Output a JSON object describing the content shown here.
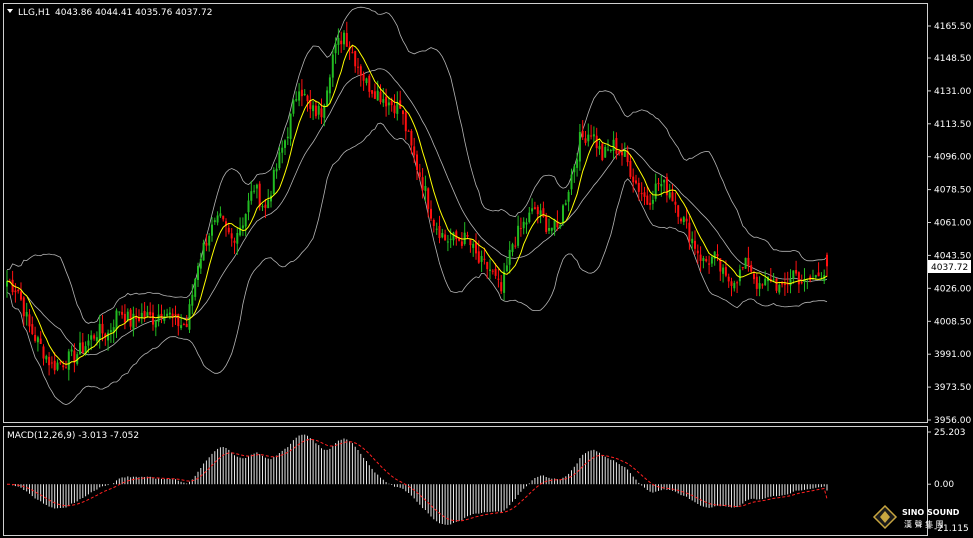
{
  "header": {
    "menu_arrow": "triangle-down-icon",
    "symbol": "LLG,H1",
    "ohlc": "4043.86 4044.41 4035.76 4037.72"
  },
  "macd_label": "MACD(12,26,9) -3.013 -7.052",
  "price_badge": "4037.72",
  "price_ticks": [
    "4165.50",
    "4148.50",
    "4131.00",
    "4113.50",
    "4096.00",
    "4078.50",
    "4061.00",
    "4043.50",
    "4026.00",
    "4008.50",
    "3991.00",
    "3973.50",
    "3956.00"
  ],
  "macd_ticks": [
    "25.203",
    "0.00",
    "-21.115"
  ],
  "logo": {
    "en": "SINO SOUND",
    "cn": "漢 聲 集 團"
  },
  "colors": {
    "bull": "#22bb22",
    "bear": "#ff1010",
    "ma": "#ffff00",
    "band": "#b4b4b4",
    "signal": "#ff2020",
    "hist": "#e6e6e6"
  },
  "chart_data": {
    "type": "candlestick",
    "interval": "H1",
    "y_range": [
      3956.0,
      4174.0
    ],
    "bands_close_anchors": [
      [
        0,
        4030
      ],
      [
        4,
        4025
      ],
      [
        8,
        4005
      ],
      [
        12,
        3995
      ],
      [
        16,
        3985
      ],
      [
        20,
        3987
      ],
      [
        24,
        3990
      ],
      [
        28,
        3996
      ],
      [
        32,
        4003
      ],
      [
        36,
        4002
      ],
      [
        40,
        4015
      ],
      [
        44,
        4008
      ],
      [
        48,
        4012
      ],
      [
        52,
        4010
      ],
      [
        56,
        4015
      ],
      [
        60,
        4008
      ],
      [
        64,
        4006
      ],
      [
        68,
        4040
      ],
      [
        72,
        4056
      ],
      [
        76,
        4062
      ],
      [
        80,
        4052
      ],
      [
        84,
        4062
      ],
      [
        88,
        4080
      ],
      [
        92,
        4068
      ],
      [
        96,
        4090
      ],
      [
        100,
        4110
      ],
      [
        104,
        4135
      ],
      [
        108,
        4120
      ],
      [
        112,
        4120
      ],
      [
        116,
        4150
      ],
      [
        120,
        4162
      ],
      [
        124,
        4148
      ],
      [
        128,
        4135
      ],
      [
        132,
        4130
      ],
      [
        136,
        4125
      ],
      [
        140,
        4122
      ],
      [
        144,
        4100
      ],
      [
        148,
        4082
      ],
      [
        152,
        4062
      ],
      [
        156,
        4052
      ],
      [
        160,
        4052
      ],
      [
        164,
        4052
      ],
      [
        168,
        4040
      ],
      [
        172,
        4036
      ],
      [
        176,
        4024
      ],
      [
        180,
        4050
      ],
      [
        184,
        4060
      ],
      [
        188,
        4068
      ],
      [
        192,
        4060
      ],
      [
        196,
        4057
      ],
      [
        200,
        4080
      ],
      [
        204,
        4105
      ],
      [
        208,
        4110
      ],
      [
        212,
        4096
      ],
      [
        216,
        4102
      ],
      [
        220,
        4096
      ],
      [
        224,
        4082
      ],
      [
        228,
        4072
      ],
      [
        232,
        4082
      ],
      [
        236,
        4078
      ],
      [
        240,
        4065
      ],
      [
        244,
        4052
      ],
      [
        248,
        4040
      ],
      [
        252,
        4042
      ],
      [
        256,
        4030
      ],
      [
        260,
        4032
      ],
      [
        264,
        4040
      ],
      [
        268,
        4025
      ],
      [
        272,
        4032
      ],
      [
        276,
        4024
      ],
      [
        280,
        4035
      ],
      [
        284,
        4028
      ],
      [
        288,
        4032
      ],
      [
        292,
        4037.72
      ]
    ],
    "macd_range": [
      -21.115,
      25.203
    ],
    "macd_final": {
      "macd": -3.013,
      "signal": -7.052
    }
  }
}
